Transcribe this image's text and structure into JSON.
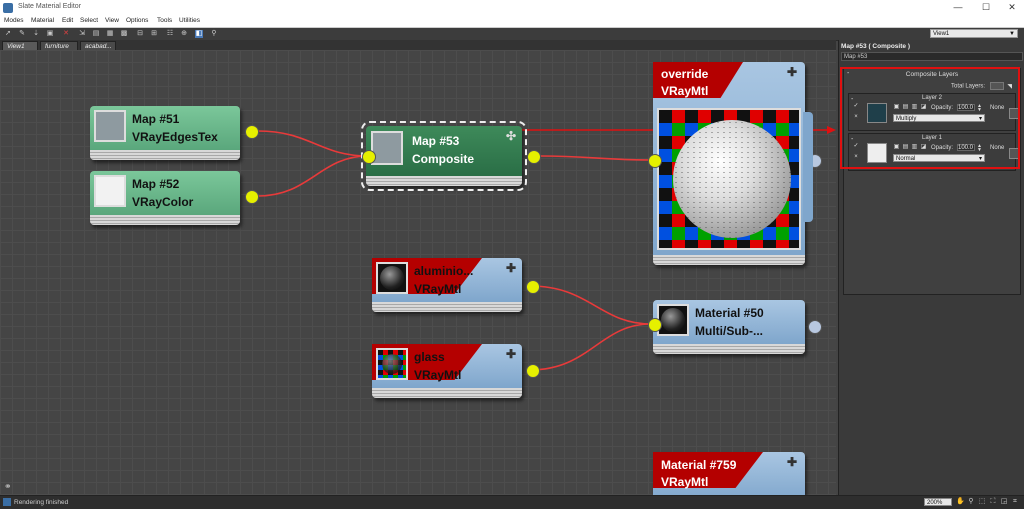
{
  "window": {
    "title": "Slate Material Editor",
    "minimize": "—",
    "maximize": "☐",
    "close": "✕"
  },
  "menu": [
    "Modes",
    "Material",
    "Edit",
    "Select",
    "View",
    "Options",
    "Tools",
    "Utilities"
  ],
  "toolbar": {
    "view_select": "View1"
  },
  "tabs": [
    "View1",
    "furniture",
    "acabad..."
  ],
  "nodes": {
    "map51": {
      "line1": "Map #51",
      "line2": "VRayEdgesTex"
    },
    "map52": {
      "line1": "Map #52",
      "line2": "VRayColor"
    },
    "map53": {
      "line1": "Map #53",
      "line2": "Composite"
    },
    "override": {
      "line1": "override",
      "line2": "VRayMtl"
    },
    "aluminio": {
      "line1": "aluminio...",
      "line2": "VRayMtl"
    },
    "glass": {
      "line1": "glass",
      "line2": "VRayMtl"
    },
    "mat50": {
      "line1": "Material #50",
      "line2": "Multi/Sub-..."
    },
    "mat759": {
      "line1": "Material #759",
      "line2": "VRayMtl"
    }
  },
  "panel": {
    "header": "Map #53  ( Composite )",
    "name": "Map #53",
    "rollout_title": "Composite Layers",
    "total_layers_label": "Total Layers:",
    "layers": [
      {
        "title": "Layer 2",
        "opacity_label": "Opacity:",
        "opacity": "100.0",
        "blend": "Multiply",
        "mask": "None",
        "color": "#1f3f4a"
      },
      {
        "title": "Layer 1",
        "opacity_label": "Opacity:",
        "opacity": "100.0",
        "blend": "Normal",
        "mask": "None",
        "color": "#eeeeee"
      }
    ]
  },
  "status": {
    "text": "Rendering finished",
    "zoom": "200%"
  },
  "colors": {
    "wire": "#e83a3a",
    "highlight": "#e01010",
    "socket": "#e6f000"
  }
}
